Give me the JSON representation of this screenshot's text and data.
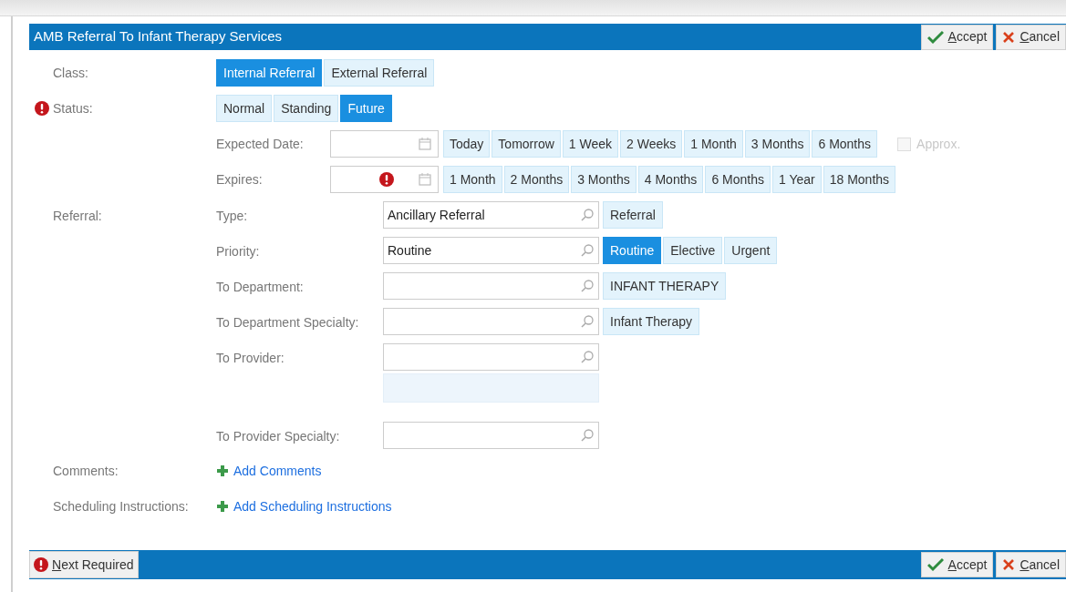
{
  "header": {
    "title": "AMB Referral To Infant Therapy Services",
    "actions": [
      {
        "kind": "accept",
        "mnemonic": "A",
        "rest": "ccept"
      },
      {
        "kind": "cancel",
        "mnemonic": "C",
        "rest": "ancel"
      }
    ]
  },
  "class": {
    "label": "Class:",
    "options": [
      {
        "label": "Internal Referral",
        "selected": true
      },
      {
        "label": "External Referral",
        "selected": false
      }
    ]
  },
  "status": {
    "label": "Status:",
    "required": true,
    "options": [
      {
        "label": "Normal",
        "selected": false
      },
      {
        "label": "Standing",
        "selected": false
      },
      {
        "label": "Future",
        "selected": true
      }
    ]
  },
  "expected_date": {
    "label": "Expected Date:",
    "quick_picks": [
      "Today",
      "Tomorrow",
      "1 Week",
      "2 Weeks",
      "1 Month",
      "3 Months",
      "6 Months"
    ],
    "approx": {
      "label": "Approx.",
      "checked": false,
      "disabled": true
    }
  },
  "expires": {
    "label": "Expires:",
    "required": true,
    "quick_picks": [
      "1 Month",
      "2 Months",
      "3 Months",
      "4 Months",
      "6 Months",
      "1 Year",
      "18 Months"
    ]
  },
  "referral": {
    "label": "Referral:",
    "fields": [
      {
        "label": "Type:",
        "value": "Ancillary Referral",
        "options": [
          {
            "label": "Referral",
            "selected": false
          }
        ]
      },
      {
        "label": "Priority:",
        "value": "Routine",
        "options": [
          {
            "label": "Routine",
            "selected": true
          },
          {
            "label": "Elective",
            "selected": false
          },
          {
            "label": "Urgent",
            "selected": false
          }
        ]
      },
      {
        "label": "To Department:",
        "options": [
          {
            "label": "INFANT THERAPY",
            "selected": false
          }
        ]
      },
      {
        "label": "To Department Specialty:",
        "options": [
          {
            "label": "Infant Therapy",
            "selected": false
          }
        ]
      },
      {
        "label": "To Provider:",
        "list_box": true
      },
      {
        "label": "To Provider Specialty:"
      }
    ]
  },
  "links": [
    {
      "label": "Comments:",
      "action": "Add Comments"
    },
    {
      "label": "Scheduling Instructions:",
      "action": "Add Scheduling Instructions"
    }
  ],
  "footer": {
    "next_required": {
      "mnemonic": "N",
      "rest": "ext Required"
    },
    "actions": [
      {
        "kind": "accept",
        "mnemonic": "A",
        "rest": "ccept"
      },
      {
        "kind": "cancel",
        "mnemonic": "C",
        "rest": "ancel"
      }
    ]
  }
}
